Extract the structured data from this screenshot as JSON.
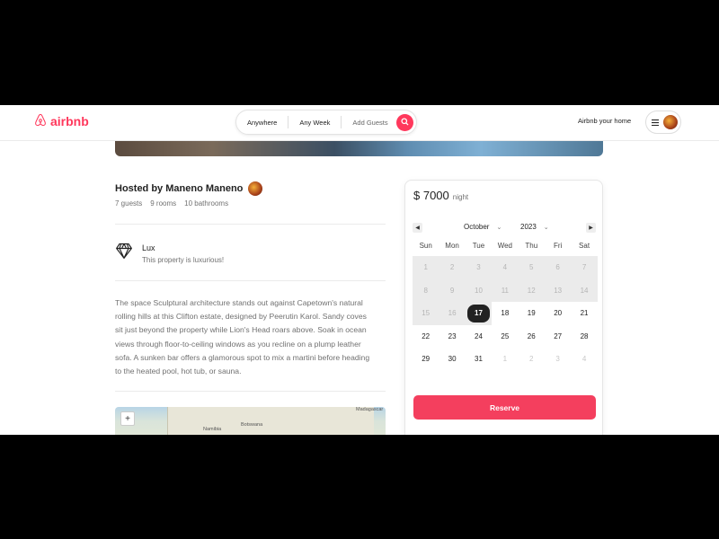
{
  "brand": {
    "name": "airbnb",
    "accent": "#ff385c",
    "logo_icon": "airbnb-belo-icon"
  },
  "search": {
    "location": "Anywhere",
    "week": "Any Week",
    "guests_placeholder": "Add Guests",
    "icon": "search-icon"
  },
  "header": {
    "host_link": "Airbnb your home",
    "menu_icon": "hamburger-icon"
  },
  "listing": {
    "host_title": "Hosted by Maneno Maneno",
    "guests": "7 guests",
    "rooms": "9 rooms",
    "bathrooms": "10 bathrooms",
    "feature": {
      "icon": "diamond-icon",
      "title": "Lux",
      "subtitle": "This property is luxurious!"
    },
    "description": "The space Sculptural architecture stands out against Capetown's natural rolling hills at this Clifton estate, designed by Peerutin Karol. Sandy coves sit just beyond the property while Lion's Head roars above. Soak in ocean views through floor-to-ceiling windows as you recline on a plump leather sofa. A sunken bar offers a glamorous spot to mix a martini before heading to the heated pool, hot tub, or sauna.",
    "map": {
      "labels": [
        "Namibia",
        "Botswana",
        "Madagascar"
      ],
      "zoom_in": "+",
      "zoom_out": "−"
    }
  },
  "booking": {
    "price": "$ 7000",
    "price_unit": "night",
    "month": "October",
    "year": "2023",
    "weekdays": [
      "Sun",
      "Mon",
      "Tue",
      "Wed",
      "Thu",
      "Fri",
      "Sat"
    ],
    "weeks": [
      [
        "1",
        "2",
        "3",
        "4",
        "5",
        "6",
        "7"
      ],
      [
        "8",
        "9",
        "10",
        "11",
        "12",
        "13",
        "14"
      ],
      [
        "15",
        "16",
        "17",
        "18",
        "19",
        "20",
        "21"
      ],
      [
        "22",
        "23",
        "24",
        "25",
        "26",
        "27",
        "28"
      ],
      [
        "29",
        "30",
        "31",
        "1",
        "2",
        "3",
        "4"
      ]
    ],
    "today": "17",
    "reserve_label": "Reserve"
  }
}
